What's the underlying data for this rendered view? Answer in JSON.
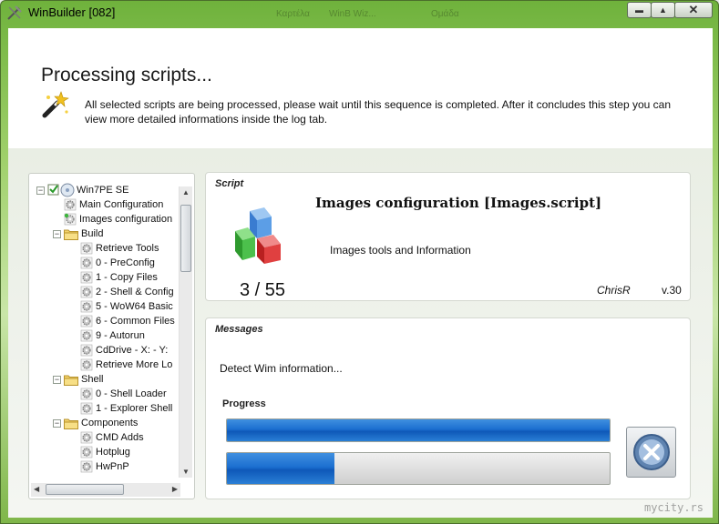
{
  "window": {
    "title": "WinBuilder [082]",
    "faint_titles": [
      "Καρτέλα",
      "WinB Wiz...",
      "Ομάδα"
    ],
    "minimize_glyph": "▬",
    "maximize_glyph": "▲",
    "close_glyph": "✕"
  },
  "header": {
    "title": "Processing scripts...",
    "description": "All selected scripts are being processed, please wait until this sequence is completed. After it concludes this step you can view more detailed informations inside the log tab."
  },
  "tree": {
    "items": [
      {
        "label": "Win7PE SE",
        "type": "root",
        "level": 0,
        "expander": "−"
      },
      {
        "label": "Main Configuration",
        "type": "script",
        "level": 1
      },
      {
        "label": "Images configuration",
        "type": "script",
        "level": 1,
        "current": true
      },
      {
        "label": "Build",
        "type": "folder",
        "level": 1,
        "expander": "−"
      },
      {
        "label": "Retrieve Tools",
        "type": "script",
        "level": 2
      },
      {
        "label": "0 - PreConfig",
        "type": "script",
        "level": 2
      },
      {
        "label": "1 - Copy Files",
        "type": "script",
        "level": 2
      },
      {
        "label": "2 - Shell & Config",
        "type": "script",
        "level": 2
      },
      {
        "label": "5 - WoW64 Basic",
        "type": "script",
        "level": 2
      },
      {
        "label": "6 - Common Files",
        "type": "script",
        "level": 2
      },
      {
        "label": "9 - Autorun",
        "type": "script",
        "level": 2
      },
      {
        "label": "CdDrive - X: - Y:",
        "type": "script",
        "level": 2
      },
      {
        "label": "Retrieve More Lo",
        "type": "script",
        "level": 2
      },
      {
        "label": "Shell",
        "type": "folder",
        "level": 1,
        "expander": "−"
      },
      {
        "label": "0 - Shell Loader",
        "type": "script",
        "level": 2
      },
      {
        "label": "1 - Explorer Shell",
        "type": "script",
        "level": 2
      },
      {
        "label": "Components",
        "type": "folder",
        "level": 1,
        "expander": "−"
      },
      {
        "label": "CMD Adds",
        "type": "script",
        "level": 2
      },
      {
        "label": "Hotplug",
        "type": "script",
        "level": 2
      },
      {
        "label": "HwPnP",
        "type": "script",
        "level": 2
      }
    ]
  },
  "script": {
    "section_label": "Script",
    "name": "Images configuration [Images.script]",
    "description": "Images tools and Information",
    "counter": "3 / 55",
    "author": "ChrisR",
    "version": "v.30"
  },
  "messages": {
    "section_label": "Messages",
    "text": "Detect Wim information...",
    "progress_label": "Progress",
    "progress_primary": 1.0,
    "progress_secondary": 0.28
  },
  "watermark": "mycity.rs",
  "colors": {
    "progress_fill": "#1c6fd0",
    "window_frame": "#6fb23c"
  }
}
